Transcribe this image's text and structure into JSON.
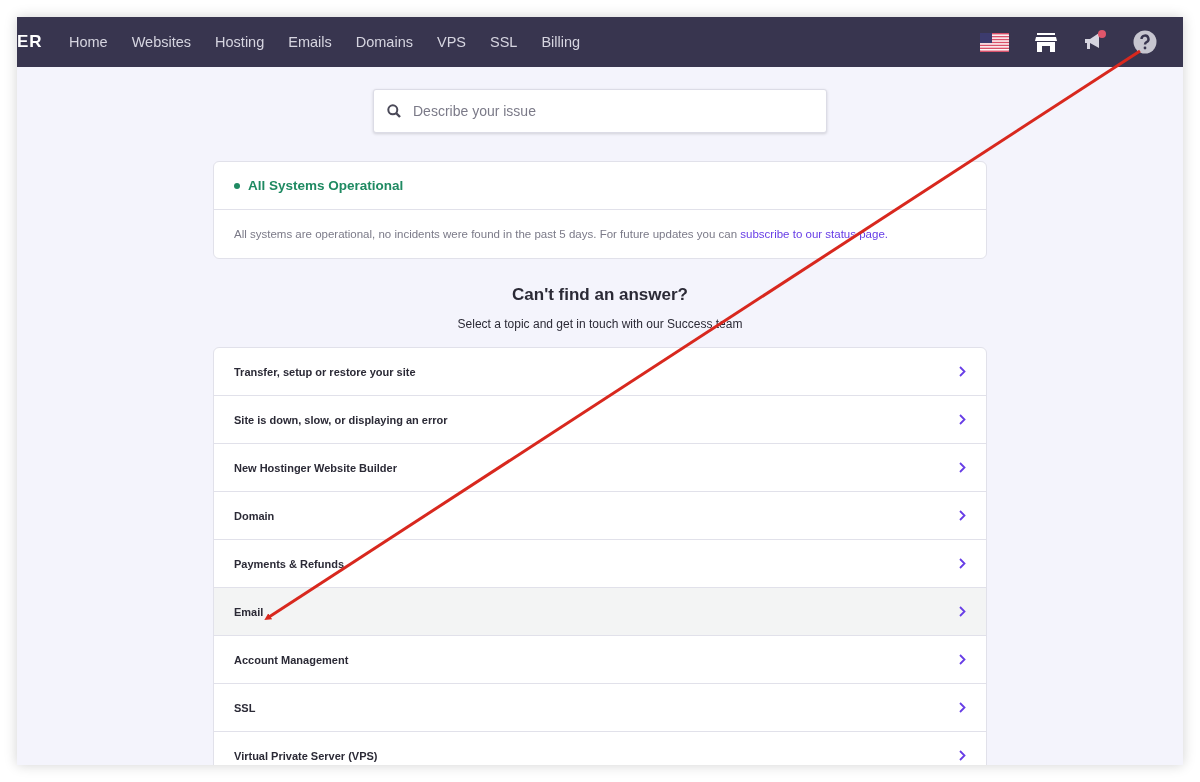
{
  "header": {
    "logo": "ER",
    "nav": [
      {
        "label": "Home"
      },
      {
        "label": "Websites"
      },
      {
        "label": "Hosting"
      },
      {
        "label": "Emails"
      },
      {
        "label": "Domains"
      },
      {
        "label": "VPS"
      },
      {
        "label": "SSL"
      },
      {
        "label": "Billing"
      }
    ],
    "notification_badge": true
  },
  "search": {
    "placeholder": "Describe your issue"
  },
  "status": {
    "title": "All Systems Operational",
    "color": "#1f8a62",
    "message": "All systems are operational, no incidents were found in the past 5 days. For future updates you can ",
    "link": "subscribe to our status page."
  },
  "help": {
    "heading": "Can't find an answer?",
    "subtitle": "Select a topic and get in touch with our Success team"
  },
  "topics": [
    {
      "label": "Transfer, setup or restore your site",
      "selected": false
    },
    {
      "label": "Site is down, slow, or displaying an error",
      "selected": false
    },
    {
      "label": "New Hostinger Website Builder",
      "selected": false
    },
    {
      "label": "Domain",
      "selected": false
    },
    {
      "label": "Payments & Refunds",
      "selected": false
    },
    {
      "label": "Email",
      "selected": true
    },
    {
      "label": "Account Management",
      "selected": false
    },
    {
      "label": "SSL",
      "selected": false
    },
    {
      "label": "Virtual Private Server (VPS)",
      "selected": false
    }
  ]
}
